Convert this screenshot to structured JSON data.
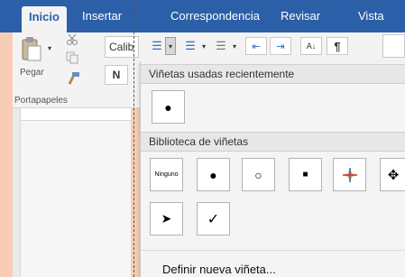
{
  "tabs": [
    "Inicio",
    "Insertar",
    "Correspondencia",
    "Revisar",
    "Vista"
  ],
  "clipboard": {
    "paste_label": "Pegar",
    "group_label": "Portapapeles"
  },
  "font": {
    "name": "Calib",
    "bold_label": "N"
  },
  "dropdown": {
    "recent_header": "Viñetas usadas recientemente",
    "library_header": "Biblioteca de viñetas",
    "none_label": "Ninguno",
    "define_label": "Definir nueva viñeta...",
    "recent_bullets": [
      "●"
    ],
    "library_bullets": [
      "●",
      "○",
      "■",
      "multicolor-star",
      "✥",
      "➤",
      "✓"
    ]
  },
  "colors": {
    "accent": "#2b5fa8",
    "background": "#f7ceb4"
  }
}
